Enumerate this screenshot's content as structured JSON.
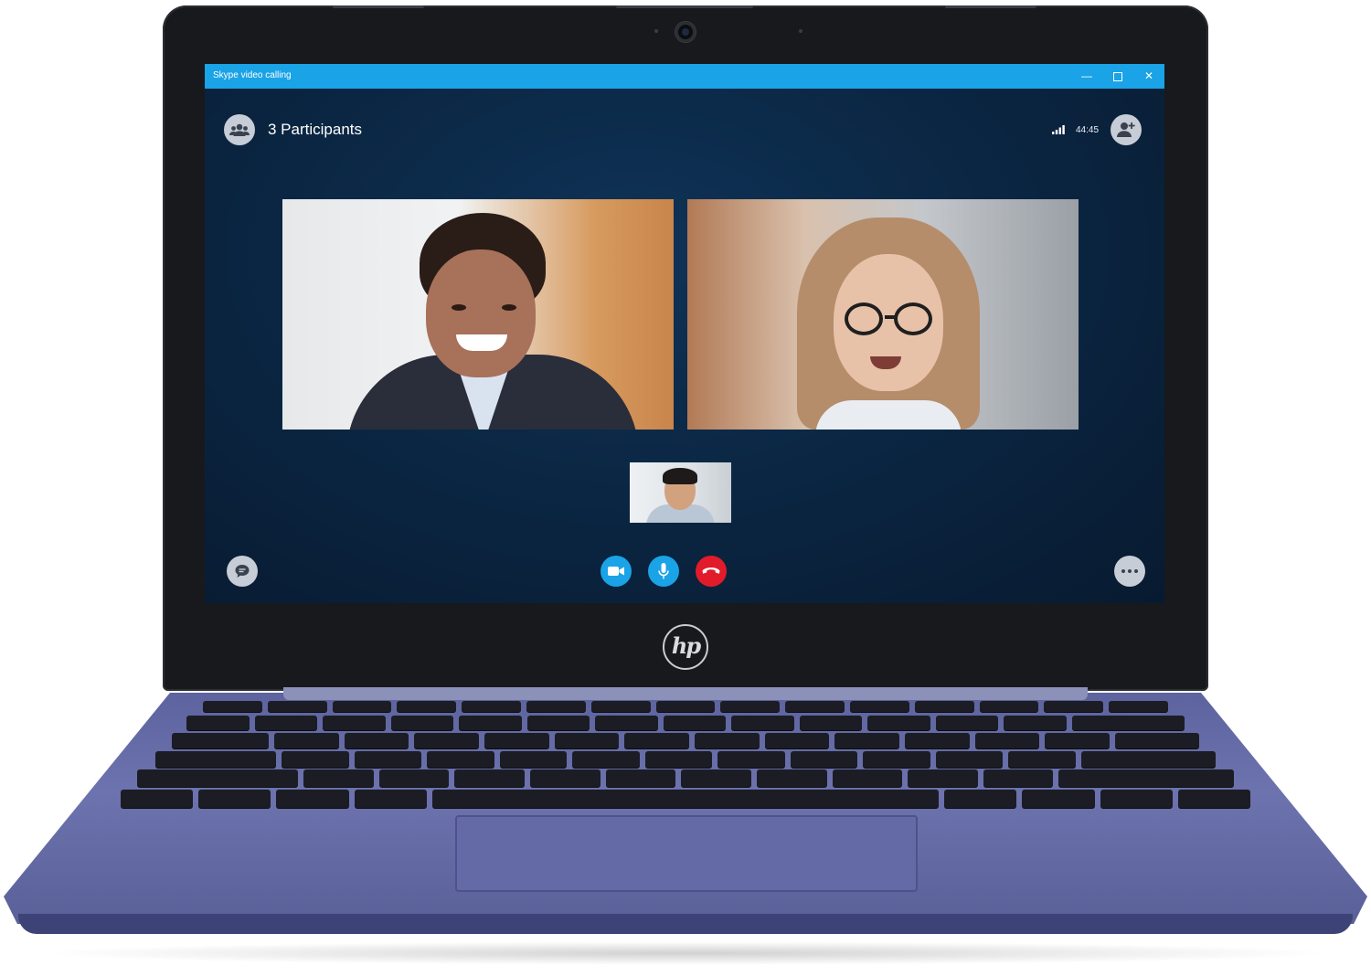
{
  "window": {
    "title": "Skype video calling",
    "minimize_glyph": "—",
    "close_glyph": "✕"
  },
  "call": {
    "participants_label": "3 Participants",
    "timer": "44:45"
  },
  "brand": {
    "logo_text": "hp"
  },
  "icons": {
    "participants": "people-icon",
    "add_person": "add-person-icon",
    "signal": "signal-icon",
    "chat": "chat-icon",
    "video": "video-camera-icon",
    "mic": "microphone-icon",
    "hangup": "hang-up-icon",
    "more": "more-icon"
  },
  "colors": {
    "titlebar": "#1aa3e6",
    "call_button": "#1aa3e6",
    "hangup_button": "#e21b2a",
    "laptop_body": "#5d639e"
  }
}
